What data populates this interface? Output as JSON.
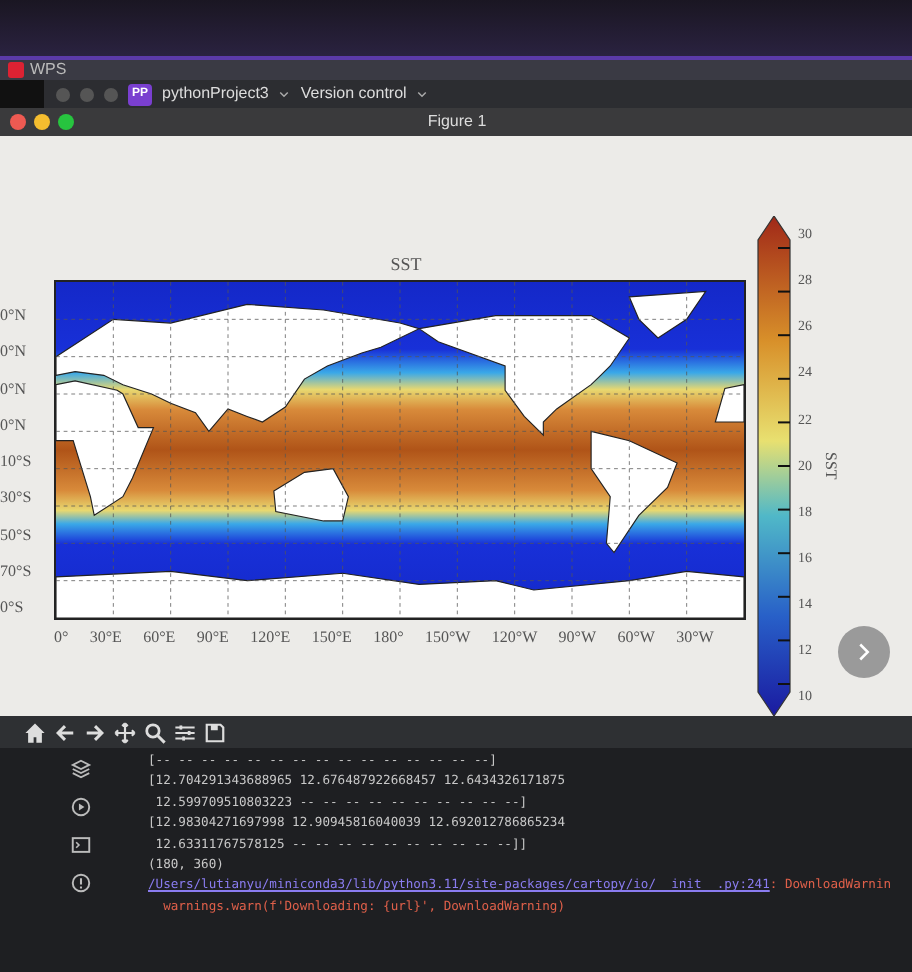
{
  "browser_tabs": [
    {
      "label": "WPS"
    }
  ],
  "ide": {
    "badge": "PP",
    "project": "pythonProject3",
    "vcs": "Version control"
  },
  "figure": {
    "title": "Figure 1",
    "plot_title": "SST",
    "lat_labels": [
      "0°N",
      "0°N",
      "0°N",
      "0°N",
      "10°S",
      "30°S",
      "50°S",
      "70°S",
      "0°S"
    ],
    "lon_labels": [
      "0°",
      "30°E",
      "60°E",
      "90°E",
      "120°E",
      "150°E",
      "180°",
      "150°W",
      "120°W",
      "90°W",
      "60°W",
      "30°W"
    ],
    "colorbar": {
      "label": "SST",
      "ticks": [
        "30",
        "28",
        "26",
        "24",
        "22",
        "20",
        "18",
        "16",
        "14",
        "12",
        "10"
      ]
    }
  },
  "console": {
    "lines": [
      {
        "kind": "text",
        "text": "[-- -- -- -- -- -- -- -- -- -- -- -- -- -- --]"
      },
      {
        "kind": "text",
        "text": "[12.704291343688965 12.676487922668457 12.6434326171875"
      },
      {
        "kind": "text",
        "text": " 12.599709510803223 -- -- -- -- -- -- -- -- -- --]"
      },
      {
        "kind": "text",
        "text": "[12.98304271697998 12.90945816040039 12.692012786865234"
      },
      {
        "kind": "text",
        "text": " 12.63311767578125 -- -- -- -- -- -- -- -- -- --]]"
      },
      {
        "kind": "text",
        "text": "(180, 360)"
      },
      {
        "kind": "link",
        "text": "/Users/lutianyu/miniconda3/lib/python3.11/site-packages/cartopy/io/__init__.py:241",
        "message": ": DownloadWarnin"
      },
      {
        "kind": "error",
        "text": "  warnings.warn(f'Downloading: {url}', DownloadWarning)"
      }
    ]
  }
}
